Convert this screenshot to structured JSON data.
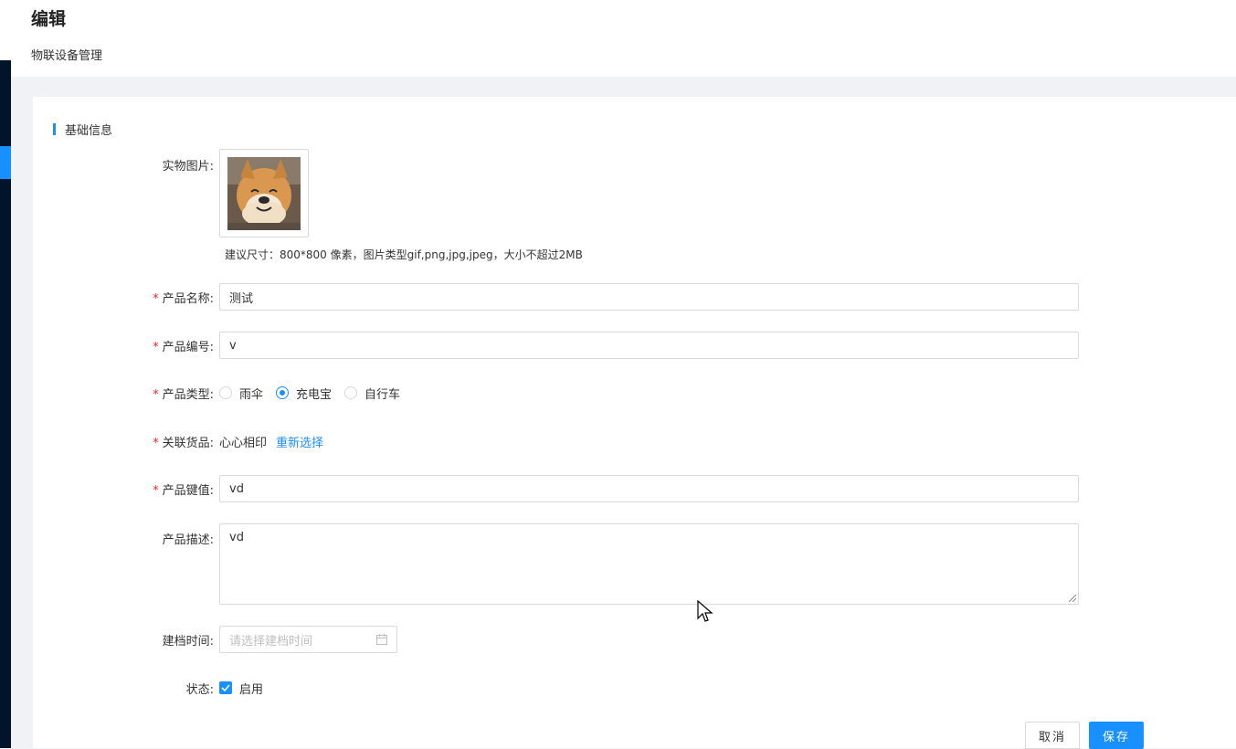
{
  "header": {
    "title": "编辑",
    "breadcrumb": "物联设备管理"
  },
  "section": {
    "title": "基础信息"
  },
  "form": {
    "image": {
      "label": "实物图片:",
      "hint": "建议尺寸：800*800 像素，图片类型gif,png,jpg,jpeg，大小不超过2MB"
    },
    "name": {
      "label": "产品名称:",
      "value": "测试"
    },
    "code": {
      "label": "产品编号:",
      "value": "v"
    },
    "type": {
      "label": "产品类型:",
      "options": [
        "雨伞",
        "充电宝",
        "自行车"
      ],
      "selected": "充电宝"
    },
    "goods": {
      "label": "关联货品:",
      "value": "心心相印",
      "action": "重新选择"
    },
    "key": {
      "label": "产品键值:",
      "value": "vd"
    },
    "desc": {
      "label": "产品描述:",
      "value": "vd"
    },
    "date": {
      "label": "建档时间:",
      "placeholder": "请选择建档时间"
    },
    "status": {
      "label": "状态:",
      "option": "启用",
      "checked": true
    }
  },
  "buttons": {
    "cancel": "取消",
    "save": "保存"
  },
  "colors": {
    "accent": "#1890ff",
    "required": "#f5222d",
    "sidebar": "#001529"
  },
  "icons": [
    "calendar-icon",
    "check-icon",
    "resize-handle-icon",
    "cursor-icon"
  ]
}
